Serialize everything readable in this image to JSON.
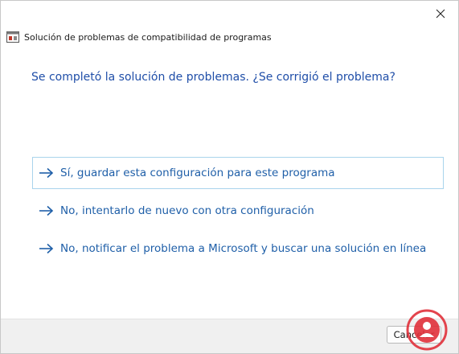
{
  "window": {
    "title": "Solución de problemas de compatibilidad de programas",
    "close_icon": "close-icon",
    "app_icon": "compatibility-troubleshooter-icon"
  },
  "main": {
    "question": "Se completó la solución de problemas. ¿Se corrigió el problema?",
    "options": [
      {
        "label": "Sí, guardar esta configuración para este programa",
        "focused": true
      },
      {
        "label": "No, intentarlo de nuevo con otra configuración",
        "focused": false
      },
      {
        "label": "No, notificar el problema a Microsoft y buscar una solución en línea",
        "focused": false
      }
    ]
  },
  "footer": {
    "cancel_label": "Cancelar"
  },
  "colors": {
    "accent_text": "#1f5fa8",
    "focus_border": "#a9d4ec",
    "watermark": "#e0303a"
  }
}
